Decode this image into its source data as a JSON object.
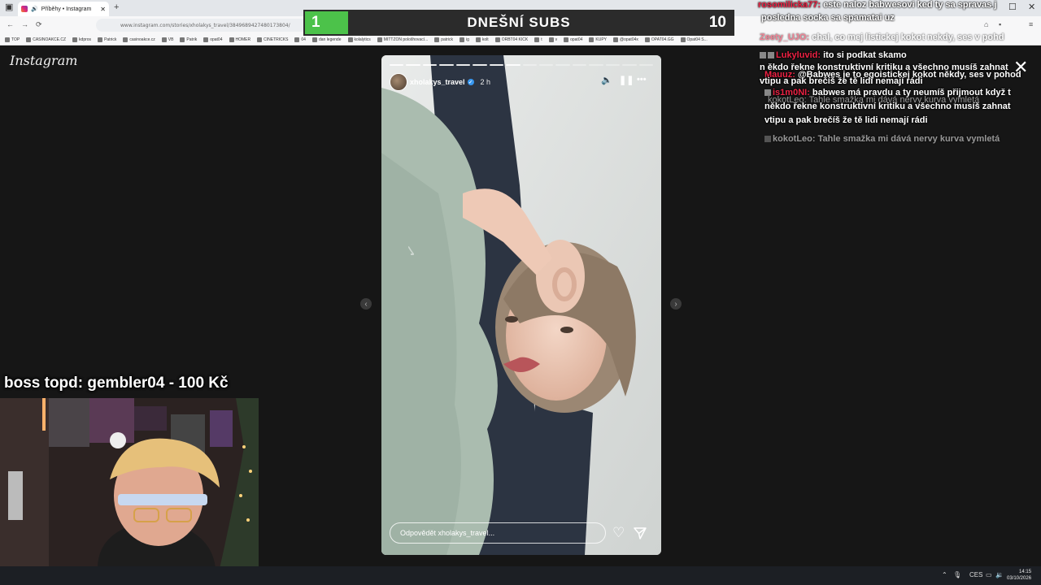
{
  "browser": {
    "tab_title": "Příběhy • Instagram",
    "url": "www.instagram.com/stories/xholakys_travel/3849689427480173804/",
    "bookmarks": [
      "TOP",
      "CASINOAKCE.CZ",
      "kdpros",
      "Patrick",
      "casinoakce.cz",
      "VB",
      "Patrik",
      "opat04",
      "HOMER",
      "CINETRICKS",
      "04",
      "dan legende",
      "kolalytics",
      "MITTZON pološhovací...",
      "patrick",
      "ig",
      "kolt",
      "ORBT04 KICK",
      "t",
      "v",
      "opat04",
      "KUPY",
      "@opat04x",
      "OPAT04.GG",
      "Opat04 S..."
    ]
  },
  "subs_overlay": {
    "current": "1",
    "title": "DNEŠNÍ SUBS",
    "goal": "10",
    "progress_fraction": 0.1
  },
  "instagram": {
    "logo": "Instagram",
    "story": {
      "username": "xholakys_travel",
      "time_ago": "2 h",
      "reply_placeholder": "Odpovědět xholakys_travel...",
      "segments_total": 16,
      "segments_done": 8
    }
  },
  "chat": {
    "messages": [
      {
        "user": "rosomilicka77:",
        "text": "este naloz babwesovi ked ty sa spravas j",
        "faded": false
      },
      {
        "user": "",
        "text": "posledna socka sa spamatai uz",
        "faded": false
      },
      {
        "user": "Zeety_UJO:",
        "text": "chal, co mej listickej kokot nekdy, ses v pohd",
        "faded": true
      },
      {
        "user": "Lukyluvid:",
        "text": "ito si podkat skamo",
        "faded": false
      },
      {
        "user": "",
        "text": "n ěkdo řekne konstruktivní kritiku a všechno musíš zahnat",
        "faded": false
      },
      {
        "user": "Mauuz:",
        "text": "@Babwes je to egoistickej kokot někdy, ses v pohod",
        "faded": false
      },
      {
        "user": "",
        "text": "vtipu a pak brečíš že tě lidi nemají rádi",
        "faded": false
      },
      {
        "user": "is1m0NI:",
        "text": "babwes má pravdu a ty neumíš přijmout když t",
        "faded": false
      },
      {
        "user": "kokotLeo:",
        "text": "Tahle smažka mi dává nervy kurva vymletá",
        "faded": true
      },
      {
        "user": "",
        "text": "někdo řekne konstruktivní kritiku a všechno musíš zahnat",
        "faded": false
      },
      {
        "user": "",
        "text": "vtipu a pak brečíš že tě lidi nemají rádi",
        "faded": false
      },
      {
        "user": "kokotLeo:",
        "text": "Tahle smažka mi dává nervy kurva vymletá",
        "faded": true
      }
    ]
  },
  "donation": {
    "text": "boss topd:  gembler04 - 100 Kč"
  },
  "taskbar": {
    "lang": "CES",
    "time": "14:15",
    "date": "03/10/2026"
  },
  "colors": {
    "progress_green": "#4cc24a",
    "bg": "#161616",
    "chat_user_red": "#e22244"
  },
  "icons": [
    "mute-icon",
    "pause-icon",
    "more-icon",
    "heart-icon",
    "send-icon",
    "close-icon",
    "chevron-left-icon",
    "chevron-right-icon"
  ]
}
